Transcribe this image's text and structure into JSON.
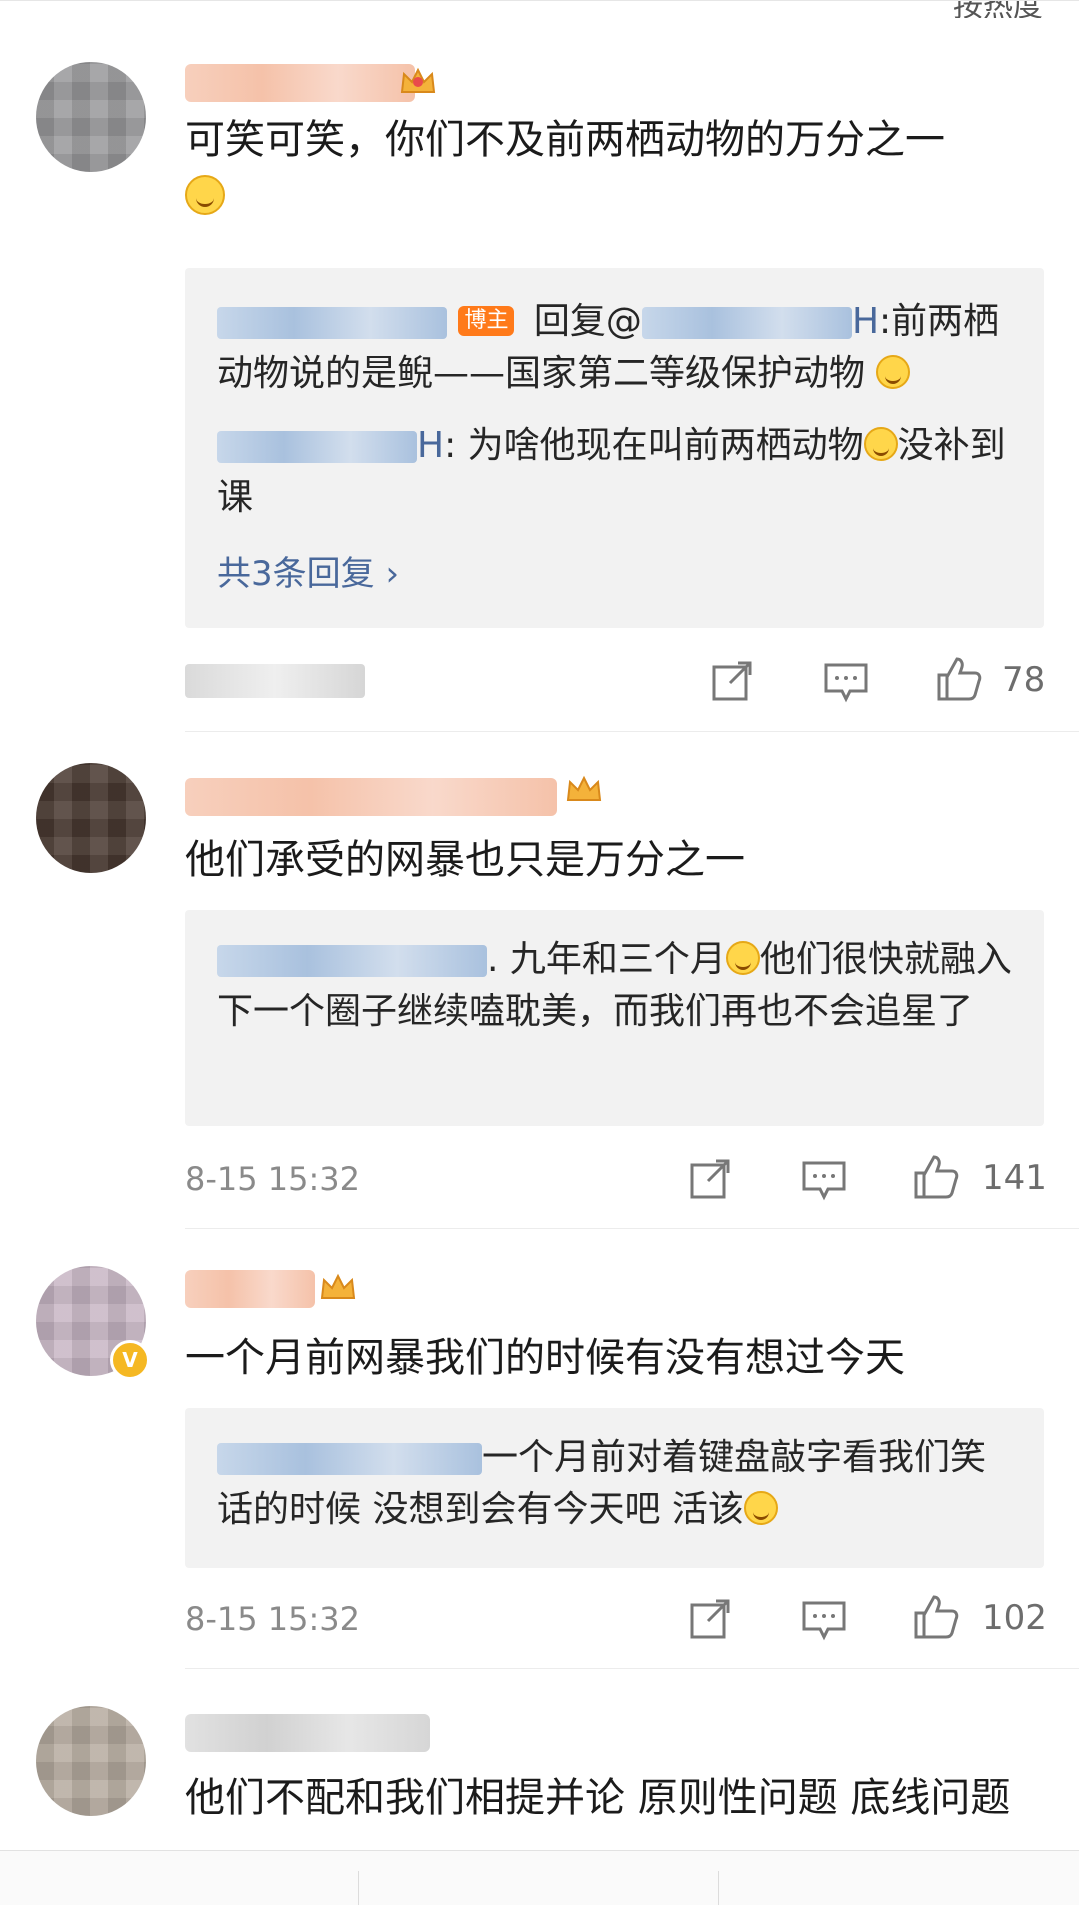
{
  "header": {
    "sort_label": "按热度"
  },
  "comments": [
    {
      "text": "可笑可笑，你们不及前两栖动物的万分之一",
      "replies": [
        {
          "badge": "博主",
          "prefix": "回复@",
          "suffix": "H",
          "body": ":前两栖动物说的是鲵——国家第二等级保护动物"
        },
        {
          "suffix": "H",
          "body": ": 为啥他现在叫前两栖动物",
          "tail": "没补到课"
        }
      ],
      "more_replies": "共3条回复 ›",
      "likes": "78"
    },
    {
      "text": "他们承受的网暴也只是万分之一",
      "reply_text": ". 九年和三个月",
      "reply_tail": "他们很快就融入下一个圈子继续嗑耽美，而我们再也不会追星了",
      "time": "8-15 15:32",
      "likes": "141"
    },
    {
      "text": "一个月前网暴我们的时候有没有想过今天",
      "reply_text": "一个月前对着键盘敲字看我们笑话的时候   没想到会有今天吧  活该",
      "time": "8-15 15:32",
      "likes": "102"
    },
    {
      "text": "他们不配和我们相提并论  原则性问题 底线问题"
    }
  ]
}
